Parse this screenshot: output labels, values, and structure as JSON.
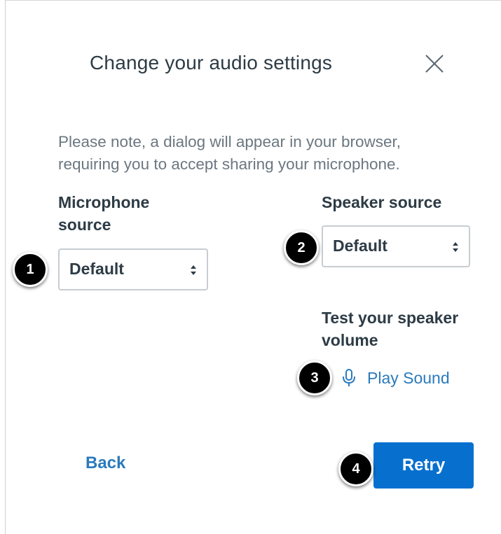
{
  "dialog": {
    "title": "Change your audio settings",
    "close_icon": "close-icon",
    "note": "Please note, a dialog will appear in your browser, requiring you to accept sharing your microphone."
  },
  "microphone": {
    "label": "Microphone source",
    "selected": "Default"
  },
  "speaker": {
    "label": "Speaker source",
    "selected": "Default"
  },
  "test": {
    "label": "Test your speaker volume",
    "play_label": "Play Sound",
    "icon": "microphone-icon"
  },
  "footer": {
    "back_label": "Back",
    "retry_label": "Retry"
  },
  "callouts": [
    "1",
    "2",
    "3",
    "4"
  ],
  "colors": {
    "link": "#2b7abc",
    "primary_button": "#0770cf",
    "text": "#2d3b45",
    "muted_text": "#6b7780",
    "callout": "#000000"
  }
}
